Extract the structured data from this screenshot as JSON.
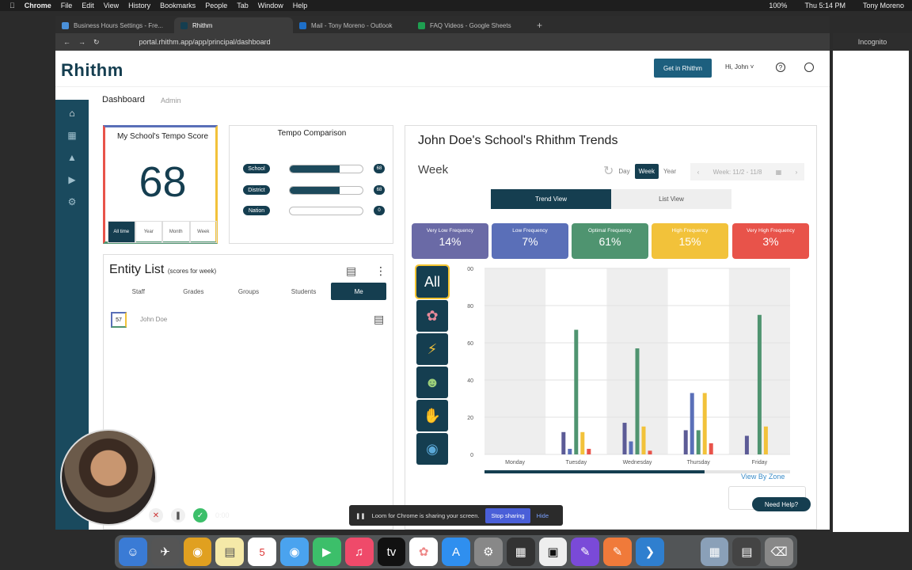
{
  "menubar": {
    "app": "Chrome",
    "items": [
      "File",
      "Edit",
      "View",
      "History",
      "Bookmarks",
      "People",
      "Tab",
      "Window",
      "Help"
    ],
    "battery": "100%",
    "clock": "Thu 5:14 PM",
    "user": "Tony Moreno"
  },
  "browser": {
    "tabs": [
      {
        "label": "Business Hours Settings - Fre...",
        "color": "#4a90d9"
      },
      {
        "label": "Rhithm",
        "color": "#153e50"
      },
      {
        "label": "Mail - Tony Moreno - Outlook",
        "color": "#1e6fc8"
      },
      {
        "label": "FAQ Videos - Google Sheets",
        "color": "#1e9e50"
      }
    ],
    "url": "portal.rhithm.app/app/principal/dashboard",
    "incognito": "Incognito"
  },
  "header": {
    "logo": "Rhithm",
    "get_in": "Get in Rhithm",
    "greeting": "Hi, John ˅",
    "help": "?"
  },
  "breadcrumb": {
    "page": "Dashboard",
    "sub": "Admin"
  },
  "score": {
    "title": "My School's Tempo Score",
    "value": "68",
    "ranges": [
      "All time",
      "Year",
      "Month",
      "Week"
    ],
    "selected": 0
  },
  "tempo": {
    "title": "Tempo Comparison",
    "rows": [
      {
        "label": "School",
        "value": "68",
        "fill": 0.68
      },
      {
        "label": "District",
        "value": "68",
        "fill": 0.68
      },
      {
        "label": "Nation",
        "value": "0",
        "fill": 0
      }
    ]
  },
  "entity": {
    "title": "Entity List",
    "subtitle": "(scores for week)",
    "tabs": [
      "Staff",
      "Grades",
      "Groups",
      "Students",
      "Me"
    ],
    "selected": 4,
    "rows": [
      {
        "score": "57",
        "name": "John Doe"
      }
    ]
  },
  "trends": {
    "title": "John Doe's School's Rhithm Trends",
    "period": "Week",
    "periods": [
      "Day",
      "Week",
      "Year"
    ],
    "selected_period": 1,
    "week_label": "Week: 11/2 - 11/8",
    "view_tabs": [
      "Trend View",
      "List View"
    ],
    "selected_view": 0,
    "frequencies": [
      {
        "label": "Very Low Frequency",
        "value": "14%",
        "color": "#6a6aa6"
      },
      {
        "label": "Low Frequency",
        "value": "7%",
        "color": "#5a6fb8"
      },
      {
        "label": "Optimal Frequency",
        "value": "61%",
        "color": "#4f9470"
      },
      {
        "label": "High Frequency",
        "value": "15%",
        "color": "#f2c23a"
      },
      {
        "label": "Very High Frequency",
        "value": "3%",
        "color": "#e8534a"
      }
    ],
    "zones": [
      "All",
      "brain-icon",
      "lightning-icon",
      "masks-icon",
      "muscle-icon",
      "speech-bubble-icon"
    ],
    "view_by_zone": "View By Zone"
  },
  "chart_data": {
    "type": "bar",
    "categories": [
      "Monday",
      "Tuesday",
      "Wednesday",
      "Thursday",
      "Friday"
    ],
    "series": [
      {
        "name": "Very Low Frequency",
        "color": "#5c5b96",
        "values": [
          0,
          12,
          17,
          13,
          10
        ]
      },
      {
        "name": "Low Frequency",
        "color": "#5a6fb8",
        "values": [
          0,
          3,
          7,
          33,
          0
        ]
      },
      {
        "name": "Optimal Frequency",
        "color": "#4f9470",
        "values": [
          0,
          67,
          57,
          13,
          75
        ]
      },
      {
        "name": "High Frequency",
        "color": "#f2c23a",
        "values": [
          0,
          12,
          15,
          33,
          15
        ]
      },
      {
        "name": "Very High Frequency",
        "color": "#e8534a",
        "values": [
          0,
          3,
          2,
          6,
          0
        ]
      }
    ],
    "ylim": [
      0,
      100
    ],
    "yticks": [
      "0",
      "20",
      "40",
      "60",
      "80",
      "00"
    ],
    "grid": true
  },
  "needhelp": "Need Help?",
  "loom": {
    "message": "Loom for Chrome is sharing your screen.",
    "stop": "Stop sharing",
    "hide": "Hide",
    "timer": "0:00"
  }
}
